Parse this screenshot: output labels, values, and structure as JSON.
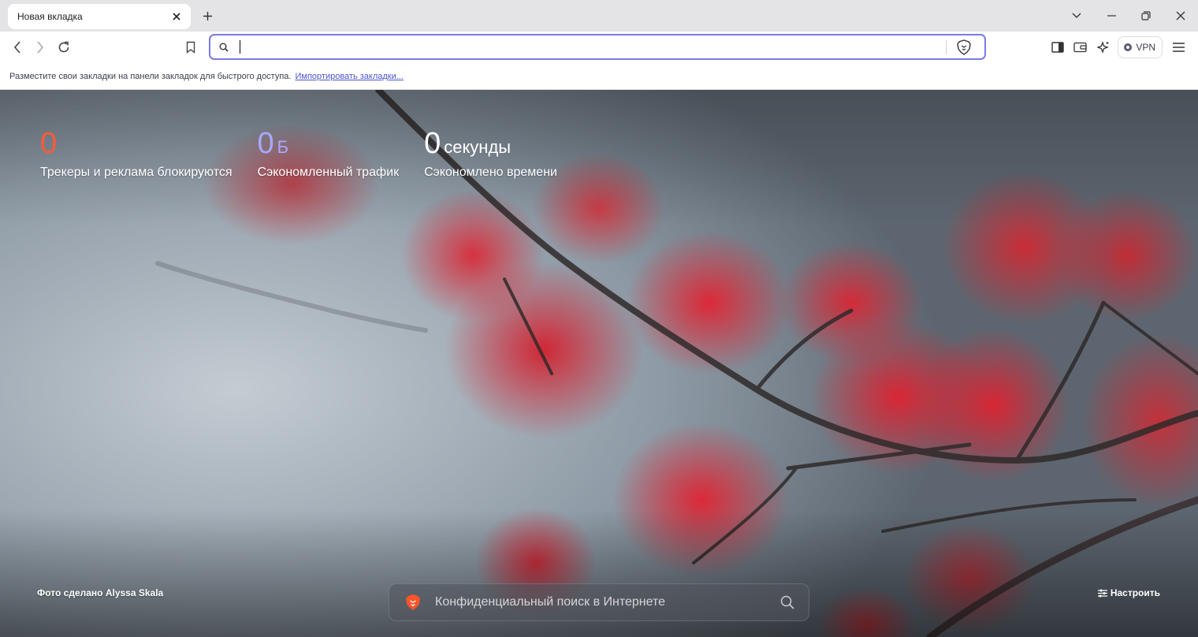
{
  "tab": {
    "title": "Новая вкладка"
  },
  "bookmarks_bar": {
    "message": "Разместите свои закладки на панели закладок для быстрого доступа.",
    "import_link": "Импортировать закладки..."
  },
  "toolbar": {
    "vpn_label": "VPN"
  },
  "omnibox": {
    "value": "",
    "placeholder": ""
  },
  "stats": {
    "trackers": {
      "value": "0",
      "unit": "",
      "label": "Трекеры и реклама блокируются",
      "color": "#ff5a3a"
    },
    "bandwidth": {
      "value": "0",
      "unit": "Б",
      "label": "Сэкономленный трафик",
      "color": "#a9a8ff"
    },
    "time": {
      "value": "0",
      "unit": "секунды",
      "label": "Сэкономлено времени",
      "color": "#ffffff"
    }
  },
  "photo_credit": "Фото сделано Alyssa Skala",
  "customize_label": "Настроить",
  "search": {
    "placeholder": "Конфиденциальный поиск в Интернете"
  },
  "colors": {
    "accent": "#7b79e6",
    "link": "#4c54d2",
    "brave_orange": "#fb542b"
  }
}
